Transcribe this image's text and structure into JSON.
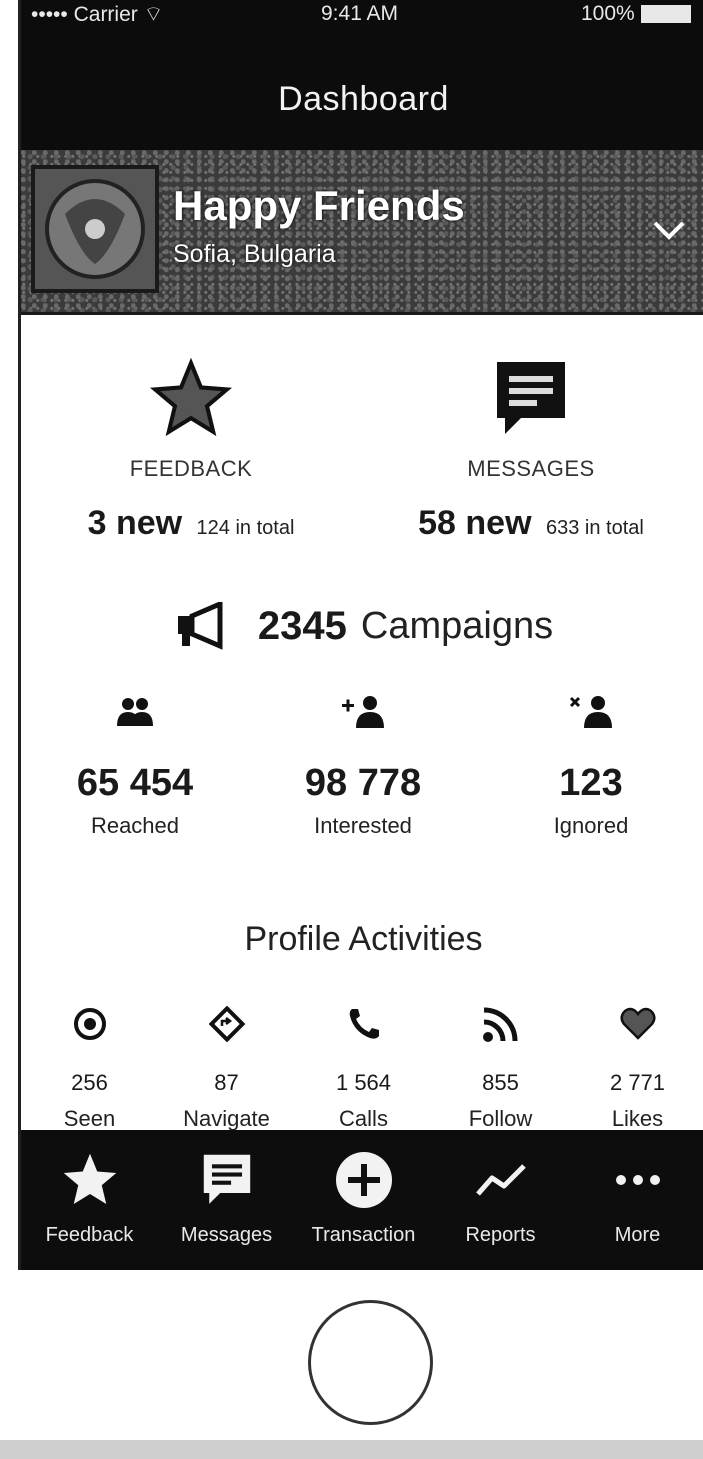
{
  "status_bar": {
    "carrier": "••••• Carrier ⌔",
    "time": "9:41 AM",
    "battery_pct": "100%"
  },
  "nav": {
    "title": "Dashboard"
  },
  "business": {
    "name": "Happy Friends",
    "location": "Sofia, Bulgaria"
  },
  "feedback": {
    "label": "FEEDBACK",
    "new": "3 new",
    "total": "124 in total",
    "icon": "star-icon"
  },
  "messages": {
    "label": "MESSAGES",
    "new": "58 new",
    "total": "633 in total",
    "icon": "message-icon"
  },
  "campaigns": {
    "count": "2345",
    "label": "Campaigns",
    "stats": [
      {
        "value": "65 454",
        "label": "Reached",
        "icon": "people-icon"
      },
      {
        "value": "98 778",
        "label": "Interested",
        "icon": "add-user-icon"
      },
      {
        "value": "123",
        "label": "Ignored",
        "icon": "remove-user-icon"
      }
    ]
  },
  "profile_activities": {
    "title": "Profile Activities",
    "items": [
      {
        "value": "256",
        "label": "Seen",
        "icon": "eye-icon"
      },
      {
        "value": "87",
        "label": "Navigate",
        "icon": "directions-icon"
      },
      {
        "value": "1 564",
        "label": "Calls",
        "icon": "phone-icon"
      },
      {
        "value": "855",
        "label": "Follow",
        "icon": "rss-icon"
      },
      {
        "value": "2 771",
        "label": "Likes",
        "icon": "heart-icon"
      }
    ]
  },
  "tabs": [
    {
      "label": "Feedback",
      "icon": "star-icon"
    },
    {
      "label": "Messages",
      "icon": "message-icon"
    },
    {
      "label": "Transaction",
      "icon": "plus-circle-icon"
    },
    {
      "label": "Reports",
      "icon": "trend-icon"
    },
    {
      "label": "More",
      "icon": "more-icon"
    }
  ],
  "colors": {
    "bar_bg": "#0c0c0c",
    "text": "#1a1a1a"
  }
}
